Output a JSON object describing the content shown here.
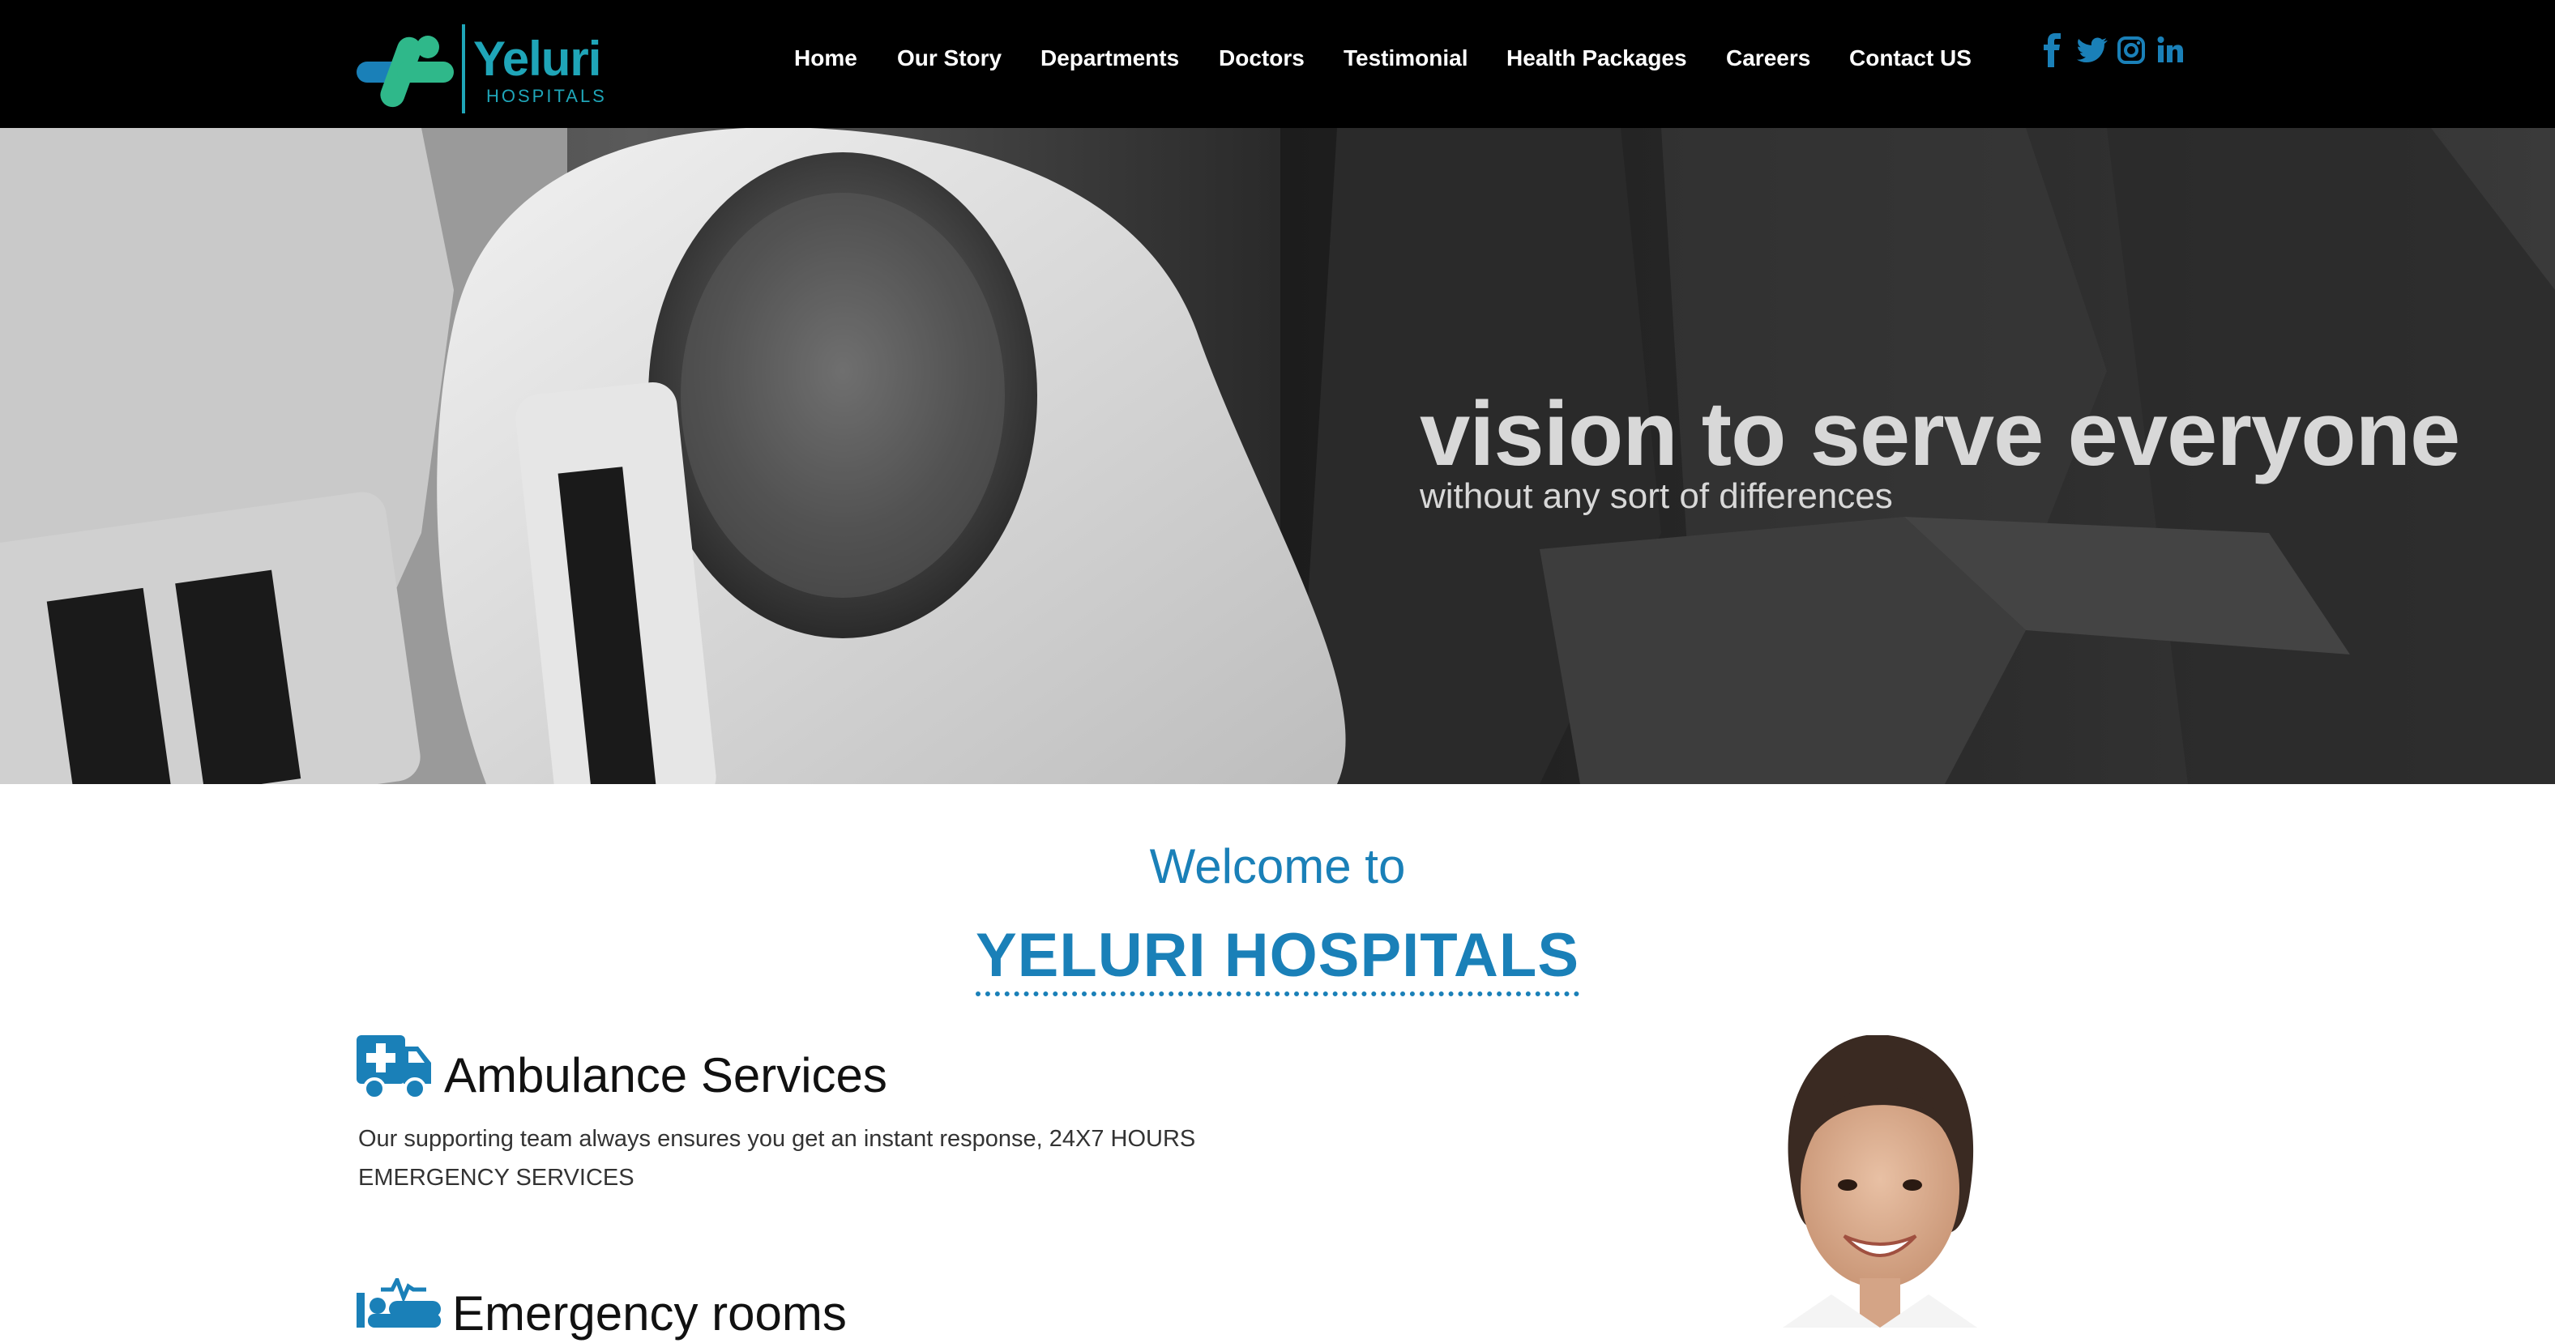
{
  "brand": {
    "logo_name": "Yeluri",
    "logo_sub": "HOSPITALS",
    "primary_color": "#1a80b8",
    "logo_color": "#1fa5b8"
  },
  "nav": {
    "items": [
      {
        "label": "Home"
      },
      {
        "label": "Our Story"
      },
      {
        "label": "Departments"
      },
      {
        "label": "Doctors"
      },
      {
        "label": "Testimonial"
      },
      {
        "label": "Health Packages"
      },
      {
        "label": "Careers"
      },
      {
        "label": "Contact US"
      }
    ],
    "social": [
      "facebook-icon",
      "twitter-icon",
      "instagram-icon",
      "linkedin-icon"
    ]
  },
  "hero": {
    "headline": "vision to serve everyone",
    "subheadline": "without any sort of differences"
  },
  "welcome": {
    "intro": "Welcome to",
    "title": "YELURI HOSPITALS"
  },
  "services": [
    {
      "icon": "ambulance-icon",
      "title": "Ambulance Services",
      "description": "Our supporting team always ensures you get an instant response, 24X7 HOURS EMERGENCY SERVICES"
    },
    {
      "icon": "emergency-bed-icon",
      "title": "Emergency rooms"
    }
  ]
}
